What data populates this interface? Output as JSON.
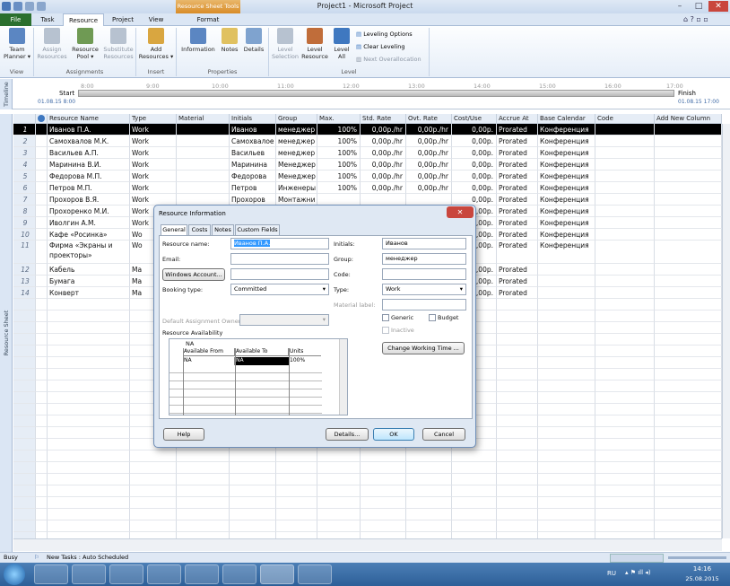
{
  "window": {
    "title": "Project1 - Microsoft Project",
    "contextual_tab": "Resource Sheet Tools"
  },
  "tabs": [
    "File",
    "Task",
    "Resource",
    "Project",
    "View",
    "Format"
  ],
  "ribbon": {
    "buttons": [
      {
        "label": "Team\nPlanner ▾",
        "dim": false
      },
      {
        "label": "Assign\nResources",
        "dim": true
      },
      {
        "label": "Resource\nPool ▾",
        "dim": false
      },
      {
        "label": "Substitute\nResources",
        "dim": true
      },
      {
        "label": "Add\nResources ▾",
        "dim": false
      },
      {
        "label": "Information",
        "dim": false
      },
      {
        "label": "Notes",
        "dim": false
      },
      {
        "label": "Details",
        "dim": false
      },
      {
        "label": "Level\nSelection",
        "dim": true
      },
      {
        "label": "Level\nResource",
        "dim": false
      },
      {
        "label": "Level\nAll",
        "dim": false
      }
    ],
    "leveling": [
      "Leveling Options",
      "Clear Leveling",
      "Next Overallocation"
    ],
    "groups": [
      "View",
      "Assignments",
      "Insert",
      "Properties",
      "Level"
    ]
  },
  "timeline": {
    "label": "Timeline",
    "start_label": "Start",
    "start_date": "01.08.15 8:00",
    "finish_label": "Finish",
    "finish_date": "01.08.15 17:00",
    "ticks": [
      "8:00",
      "9:00",
      "10:00",
      "11:00",
      "12:00",
      "13:00",
      "14:00",
      "15:00",
      "16:00",
      "17:00"
    ]
  },
  "sheet": {
    "side_label": "Resource Sheet",
    "columns": [
      "Resource Name",
      "Type",
      "Material",
      "Initials",
      "Group",
      "Max.",
      "Std. Rate",
      "Ovt. Rate",
      "Cost/Use",
      "Accrue At",
      "Base Calendar",
      "Code",
      "Add New Column"
    ],
    "rows": [
      {
        "id": "1",
        "name": "Иванов П.А.",
        "type": "Work",
        "initials": "Иванов",
        "group": "менеджер",
        "max": "100%",
        "std": "0,00р./hr",
        "ovt": "0,00р./hr",
        "cost": "0,00р.",
        "accrue": "Prorated",
        "cal": "Конференция"
      },
      {
        "id": "2",
        "name": "Самохвалов М.К.",
        "type": "Work",
        "initials": "Самохвалое",
        "group": "менеджер",
        "max": "100%",
        "std": "0,00р./hr",
        "ovt": "0,00р./hr",
        "cost": "0,00р.",
        "accrue": "Prorated",
        "cal": "Конференция"
      },
      {
        "id": "3",
        "name": "Васильев А.П.",
        "type": "Work",
        "initials": "Васильев",
        "group": "менеджер",
        "max": "100%",
        "std": "0,00р./hr",
        "ovt": "0,00р./hr",
        "cost": "0,00р.",
        "accrue": "Prorated",
        "cal": "Конференция"
      },
      {
        "id": "4",
        "name": "Маринина В.И.",
        "type": "Work",
        "initials": "Маринина",
        "group": "Менеджер",
        "max": "100%",
        "std": "0,00р./hr",
        "ovt": "0,00р./hr",
        "cost": "0,00р.",
        "accrue": "Prorated",
        "cal": "Конференция"
      },
      {
        "id": "5",
        "name": "Федорова М.П.",
        "type": "Work",
        "initials": "Федорова",
        "group": "Менеджер",
        "max": "100%",
        "std": "0,00р./hr",
        "ovt": "0,00р./hr",
        "cost": "0,00р.",
        "accrue": "Prorated",
        "cal": "Конференция"
      },
      {
        "id": "6",
        "name": "Петров М.П.",
        "type": "Work",
        "initials": "Петров",
        "group": "Инженеры",
        "max": "100%",
        "std": "0,00р./hr",
        "ovt": "0,00р./hr",
        "cost": "0,00р.",
        "accrue": "Prorated",
        "cal": "Конференция"
      },
      {
        "id": "7",
        "name": "Прохоров В.Я.",
        "type": "Work",
        "initials": "Прохоров",
        "group": "Монтажни",
        "max": "",
        "std": "",
        "ovt": "",
        "cost": "0,00р.",
        "accrue": "Prorated",
        "cal": "Конференция"
      },
      {
        "id": "8",
        "name": "Прохоренко М.И.",
        "type": "Work",
        "initials": "",
        "group": "",
        "max": "",
        "std": "",
        "ovt": "",
        "cost": "0,00р.",
        "accrue": "Prorated",
        "cal": "Конференция"
      },
      {
        "id": "9",
        "name": "Иволгин А.М.",
        "type": "Work",
        "initials": "",
        "group": "",
        "max": "",
        "std": "",
        "ovt": "",
        "cost": "0,00р.",
        "accrue": "Prorated",
        "cal": "Конференция"
      },
      {
        "id": "10",
        "name": "Кафе «Росинка»",
        "type": "Wo",
        "initials": "",
        "group": "",
        "max": "",
        "std": "",
        "ovt": "",
        "cost": "0,00р.",
        "accrue": "Prorated",
        "cal": "Конференция"
      },
      {
        "id": "11",
        "name": "Фирма «Экраны и проекторы»",
        "type": "Wo",
        "initials": "",
        "group": "",
        "max": "",
        "std": "",
        "ovt": "",
        "cost": "0,00р.",
        "accrue": "Prorated",
        "cal": "Конференция"
      },
      {
        "id": "12",
        "name": "Кабель",
        "type": "Ma",
        "initials": "",
        "group": "",
        "max": "",
        "std": "",
        "ovt": "",
        "cost": "0,00р.",
        "accrue": "Prorated",
        "cal": ""
      },
      {
        "id": "13",
        "name": "Бумага",
        "type": "Ma",
        "initials": "",
        "group": "",
        "max": "",
        "std": "",
        "ovt": "",
        "cost": "0,00р.",
        "accrue": "Prorated",
        "cal": ""
      },
      {
        "id": "14",
        "name": "Конверт",
        "type": "Ma",
        "initials": "",
        "group": "",
        "max": "",
        "std": "",
        "ovt": "",
        "cost": "0,00р.",
        "accrue": "Prorated",
        "cal": ""
      }
    ]
  },
  "dialog": {
    "title": "Resource Information",
    "tabs": [
      "General",
      "Costs",
      "Notes",
      "Custom Fields"
    ],
    "resource_name_label": "Resource name:",
    "resource_name": "Иванов П.А.",
    "initials_label": "Initials:",
    "initials": "Иванов",
    "email_label": "Email:",
    "group_label": "Group:",
    "group": "менеджер",
    "windows_account": "Windows Account...",
    "code_label": "Code:",
    "booking_label": "Booking type:",
    "booking": "Committed",
    "type_label": "Type:",
    "type": "Work",
    "material_label": "Material label:",
    "owner_label": "Default Assignment Owner:",
    "generic": "Generic",
    "budget": "Budget",
    "inactive": "Inactive",
    "change_time": "Change Working Time ...",
    "availability_label": "Resource Availability",
    "avail_top": "NA",
    "avail_cols": [
      "Available From",
      "Available To",
      "Units"
    ],
    "avail_row": [
      "NA",
      "NA",
      "100%"
    ],
    "help": "Help",
    "details": "Details...",
    "ok": "OK",
    "cancel": "Cancel"
  },
  "status": {
    "mode": "Busy",
    "tasks": "New Tasks : Auto Scheduled"
  },
  "tray": {
    "lang": "RU",
    "time": "14:16",
    "date": "25.08.2015"
  }
}
